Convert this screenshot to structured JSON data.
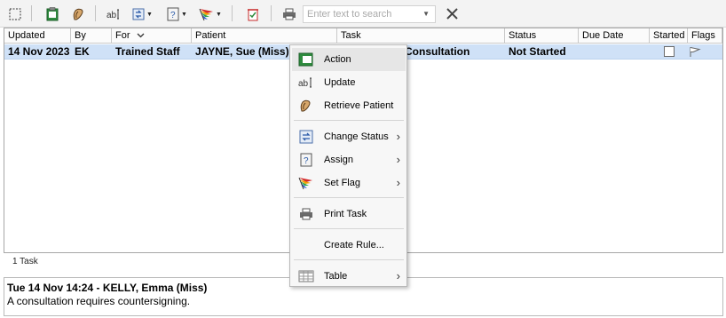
{
  "toolbar": {
    "search_placeholder": "Enter text to search",
    "buttons": [
      "select-all-icon",
      "action-icon",
      "retrieve-patient-icon",
      "update-icon",
      "change-status-icon",
      "assign-icon",
      "set-flag-icon",
      "delete-task-icon",
      "print-icon",
      "clear-search-icon"
    ]
  },
  "grid": {
    "columns": [
      "Updated",
      "By",
      "For",
      "Patient",
      "Task",
      "Status",
      "Due Date",
      "Started",
      "Flags"
    ],
    "sort_indicator": "chevron-down-icon",
    "rows": [
      {
        "updated": "14 Nov 2023",
        "by": "EK",
        "for": "Trained Staff",
        "patient": "JAYNE, Sue (Miss)",
        "task": "Consultation",
        "status": "Not Started",
        "due_date": "",
        "started": false,
        "flag_icon": "flag-outline-icon"
      }
    ]
  },
  "status_bar": {
    "count": "1 Task"
  },
  "detail": {
    "title": "Tue 14 Nov 14:24 - KELLY, Emma (Miss)",
    "body": "A consultation requires countersigning."
  },
  "context_menu": {
    "items": [
      {
        "label": "Action",
        "icon": "action-icon",
        "submenu": false,
        "hover": true
      },
      {
        "label": "Update",
        "icon": "update-icon",
        "submenu": false
      },
      {
        "label": "Retrieve Patient",
        "icon": "retrieve-patient-icon",
        "submenu": false
      },
      {
        "label": "Change Status",
        "icon": "change-status-icon",
        "submenu": true
      },
      {
        "label": "Assign",
        "icon": "assign-icon",
        "submenu": true
      },
      {
        "label": "Set Flag",
        "icon": "set-flag-icon",
        "submenu": true
      },
      {
        "label": "Print Task",
        "icon": "print-icon",
        "submenu": false
      },
      {
        "label": "Create Rule...",
        "icon": "",
        "submenu": false
      },
      {
        "label": "Table",
        "icon": "table-icon",
        "submenu": true
      }
    ]
  },
  "colors": {
    "selected_row": "#cfe1f7",
    "toolbar_bg": "#f3f3f3",
    "menu_bg": "#f7f7f7",
    "menu_hover": "#e6e6e6"
  }
}
